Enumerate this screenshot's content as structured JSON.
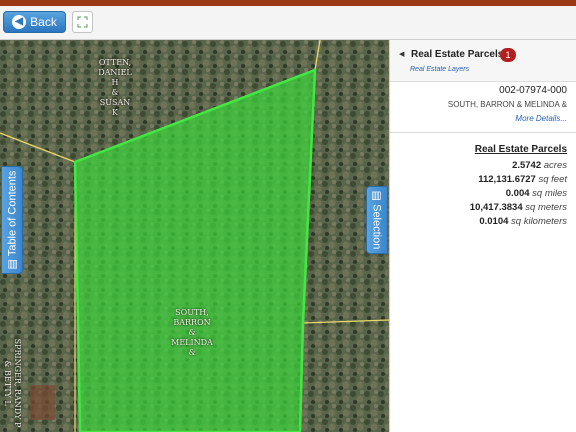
{
  "toolbar": {
    "back_label": "Back",
    "back_icon": "arrow-left-circle-icon",
    "expand_icon": "expand-icon"
  },
  "map": {
    "parcel_color": "#3cd43c",
    "labels": {
      "otten": "OTTEN, DANIEL H & SUSAN K",
      "otten_lines": [
        "OTTEN,",
        "DANIEL",
        "H",
        "&",
        "SUSAN",
        "K"
      ],
      "south_lines": [
        "SOUTH,",
        "BARRON",
        "&",
        "MELINDA",
        "&"
      ],
      "springer_lines": [
        "SPRINGER,",
        "RANDY",
        "P",
        "&",
        "BETTY",
        "L"
      ]
    },
    "toc_label": "Table of Contents",
    "selection_label": "Selection"
  },
  "panel": {
    "layer_title": "Real Estate Parcels",
    "badge_count": "1",
    "layer_subtitle": "Real Estate Layers",
    "parcel_id": "002-07974-000",
    "owner": "SOUTH, BARRON & MELINDA &",
    "more_label": "More Details...",
    "stats_title": "Real Estate Parcels",
    "stats": [
      {
        "value": "2.5742",
        "unit": "acres"
      },
      {
        "value": "112,131.6727",
        "unit": "sq feet"
      },
      {
        "value": "0.004",
        "unit": "sq miles"
      },
      {
        "value": "10,417.3834",
        "unit": "sq meters"
      },
      {
        "value": "0.0104",
        "unit": "sq kilometers"
      }
    ]
  }
}
